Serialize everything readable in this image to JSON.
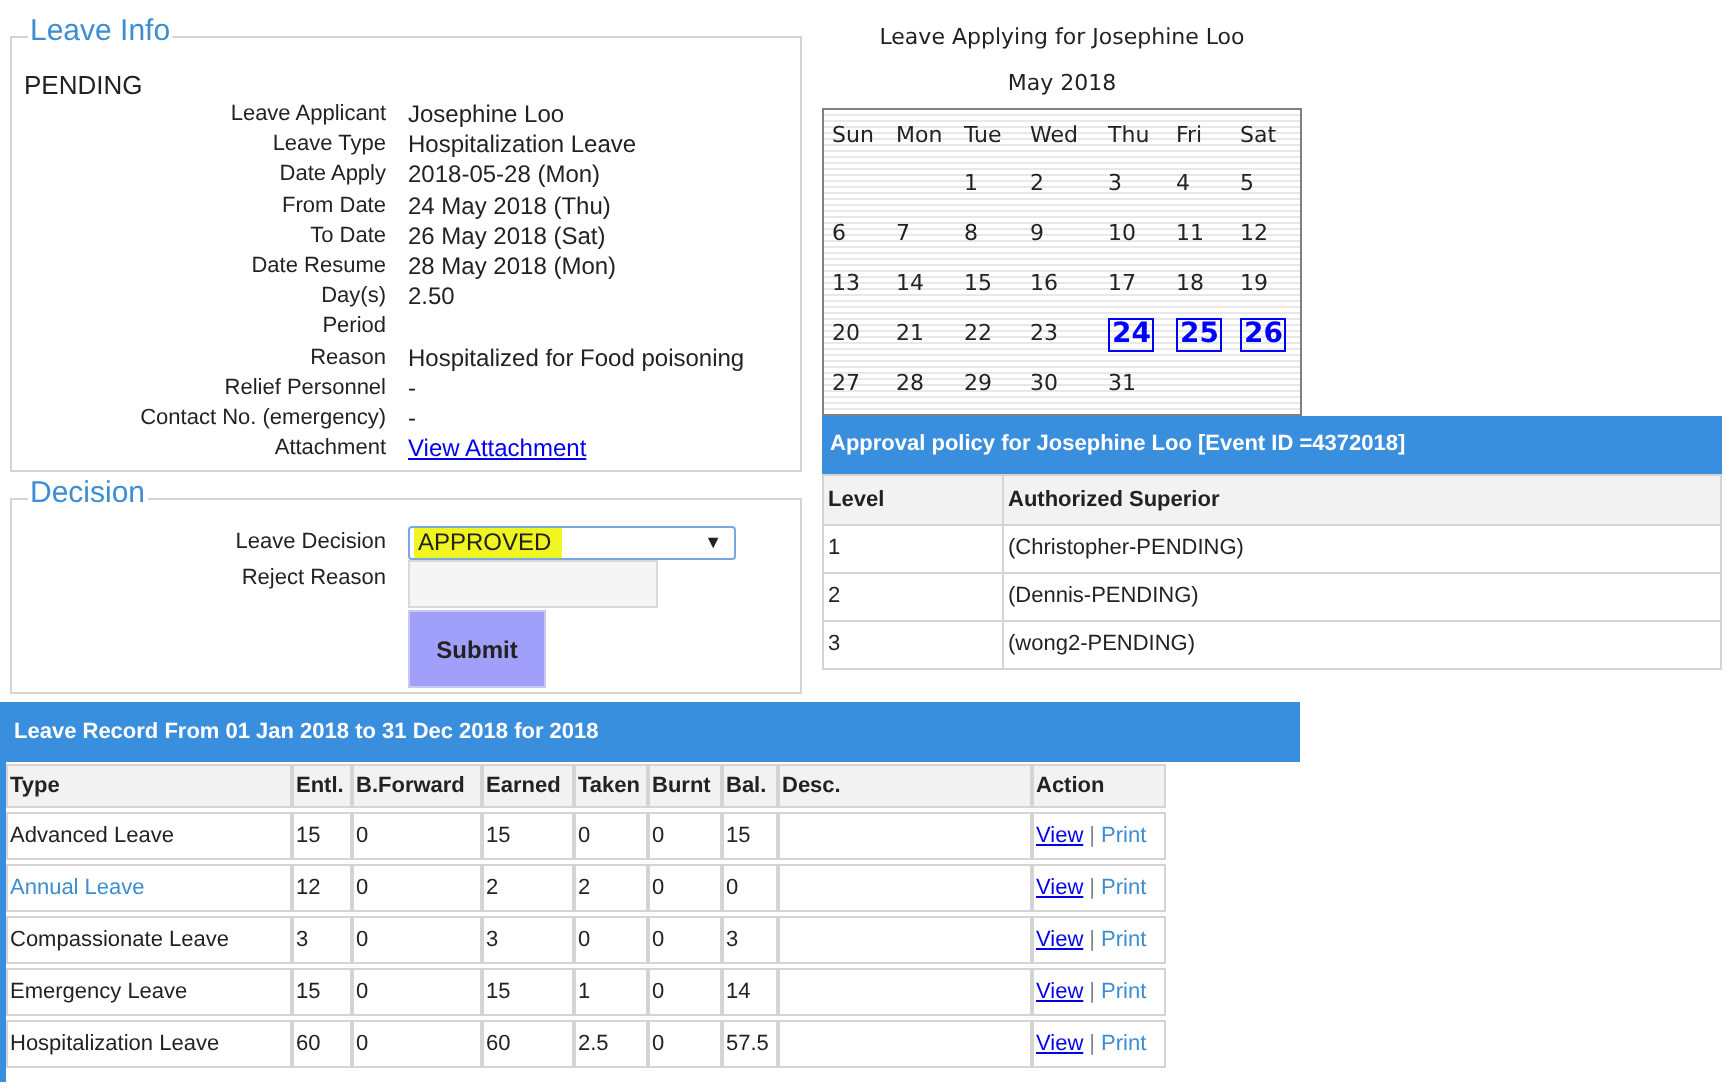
{
  "leave_info": {
    "legend": "Leave Info",
    "status": "PENDING",
    "fields": [
      {
        "label": "Leave Applicant",
        "value": "Josephine Loo"
      },
      {
        "label": "Leave Type",
        "value": "Hospitalization Leave"
      },
      {
        "label": "Date Apply",
        "value": "2018-05-28 (Mon)"
      },
      {
        "label": "From Date",
        "value": "24 May 2018 (Thu)"
      },
      {
        "label": "To Date",
        "value": "26 May 2018 (Sat)"
      },
      {
        "label": "Date Resume",
        "value": "28 May 2018 (Mon)"
      },
      {
        "label": "Day(s)",
        "value": "2.50"
      },
      {
        "label": "Period"
      },
      {
        "label": "Reason",
        "value": "Hospitalized for Food poisoning"
      },
      {
        "label": "Relief Personnel",
        "value": "-"
      },
      {
        "label": "Contact No. (emergency)",
        "value": "-"
      },
      {
        "label": "Attachment",
        "value": "View Attachment",
        "kind": "link"
      }
    ]
  },
  "decision": {
    "legend": "Decision",
    "decision_label": "Leave Decision",
    "decision_value": "APPROVED",
    "highlighted": true,
    "dropdown_glyph": "▼",
    "reject_label": "Reject Reason",
    "submit": "Submit"
  },
  "calendar": {
    "title": "Leave Applying for Josephine Loo",
    "month": "May 2018",
    "weekdays": [
      "Sun",
      "Mon",
      "Tue",
      "Wed",
      "Thu",
      "Fri",
      "Sat"
    ],
    "weeks": [
      [
        {
          "kind": "empty"
        },
        {
          "kind": "empty"
        },
        {
          "kind": "day",
          "day": "1",
          "highlighted": false
        },
        {
          "kind": "day",
          "day": "2",
          "highlighted": false
        },
        {
          "kind": "day",
          "day": "3",
          "highlighted": false
        },
        {
          "kind": "day",
          "day": "4",
          "highlighted": false
        },
        {
          "kind": "day",
          "day": "5",
          "highlighted": false
        }
      ],
      [
        {
          "kind": "day",
          "day": "6",
          "highlighted": false
        },
        {
          "kind": "day",
          "day": "7",
          "highlighted": false
        },
        {
          "kind": "day",
          "day": "8",
          "highlighted": false
        },
        {
          "kind": "day",
          "day": "9",
          "highlighted": false
        },
        {
          "kind": "day",
          "day": "10",
          "highlighted": false
        },
        {
          "kind": "day",
          "day": "11",
          "highlighted": false
        },
        {
          "kind": "day",
          "day": "12",
          "highlighted": false
        }
      ],
      [
        {
          "kind": "day",
          "day": "13",
          "highlighted": false
        },
        {
          "kind": "day",
          "day": "14",
          "highlighted": false
        },
        {
          "kind": "day",
          "day": "15",
          "highlighted": false
        },
        {
          "kind": "day",
          "day": "16",
          "highlighted": false
        },
        {
          "kind": "day",
          "day": "17",
          "highlighted": false
        },
        {
          "kind": "day",
          "day": "18",
          "highlighted": false
        },
        {
          "kind": "day",
          "day": "19",
          "highlighted": false
        }
      ],
      [
        {
          "kind": "day",
          "day": "20",
          "highlighted": false
        },
        {
          "kind": "day",
          "day": "21",
          "highlighted": false
        },
        {
          "kind": "day",
          "day": "22",
          "highlighted": false
        },
        {
          "kind": "day",
          "day": "23",
          "highlighted": false
        },
        {
          "kind": "day",
          "day": "24",
          "highlighted": true
        },
        {
          "kind": "day",
          "day": "25",
          "highlighted": true
        },
        {
          "kind": "day",
          "day": "26",
          "highlighted": true
        }
      ],
      [
        {
          "kind": "day",
          "day": "27",
          "highlighted": false
        },
        {
          "kind": "day",
          "day": "28",
          "highlighted": false
        },
        {
          "kind": "day",
          "day": "29",
          "highlighted": false
        },
        {
          "kind": "day",
          "day": "30",
          "highlighted": false
        },
        {
          "kind": "day",
          "day": "31",
          "highlighted": false
        },
        {
          "kind": "empty"
        },
        {
          "kind": "empty"
        }
      ]
    ]
  },
  "approval": {
    "title": "Approval policy for Josephine Loo [Event ID =4372018]",
    "columns": [
      "Level",
      "Authorized Superior"
    ],
    "rows": [
      [
        "1",
        "(Christopher-PENDING)"
      ],
      [
        "2",
        "(Dennis-PENDING)"
      ],
      [
        "3",
        "(wong2-PENDING)"
      ]
    ]
  },
  "leave_record": {
    "title": "Leave Record From 01 Jan 2018 to 31 Dec 2018 for 2018",
    "columns": [
      "Type",
      "Entl.",
      "B.Forward",
      "Earned",
      "Taken",
      "Burnt",
      "Bal.",
      "Desc.",
      "Action"
    ],
    "rows": [
      {
        "type": "Advanced Leave",
        "kind": "text",
        "values": [
          "15",
          "0",
          "15",
          "0",
          "0",
          "15"
        ],
        "view": "View",
        "separator": "|",
        "print": "Print"
      },
      {
        "type": "Annual Leave",
        "kind": "link",
        "values": [
          "12",
          "0",
          "2",
          "2",
          "0",
          "0"
        ],
        "view": "View",
        "separator": "|",
        "print": "Print"
      },
      {
        "type": "Compassionate Leave",
        "kind": "text",
        "values": [
          "3",
          "0",
          "3",
          "0",
          "0",
          "3"
        ],
        "view": "View",
        "separator": "|",
        "print": "Print"
      },
      {
        "type": "Emergency Leave",
        "kind": "text",
        "values": [
          "15",
          "0",
          "15",
          "1",
          "0",
          "14"
        ],
        "view": "View",
        "separator": "|",
        "print": "Print"
      },
      {
        "type": "Hospitalization Leave",
        "kind": "text",
        "values": [
          "60",
          "0",
          "60",
          "2.5",
          "0",
          "57.5"
        ],
        "view": "View",
        "separator": "|",
        "print": "Print"
      }
    ]
  }
}
